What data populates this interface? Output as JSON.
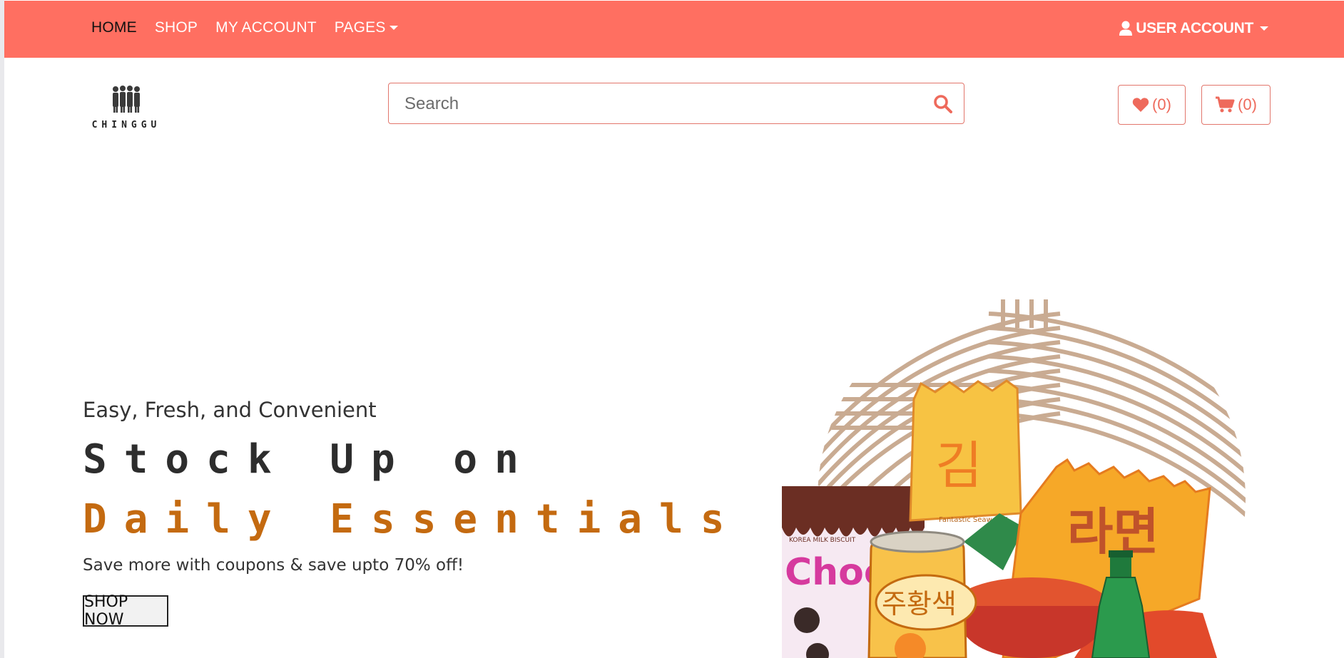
{
  "nav": {
    "items": [
      {
        "label": "HOME",
        "active": true
      },
      {
        "label": "SHOP",
        "active": false
      },
      {
        "label": "MY ACCOUNT",
        "active": false
      },
      {
        "label": "PAGES",
        "active": false,
        "dropdown": true
      }
    ],
    "account_label": "USER ACCOUNT"
  },
  "brand": {
    "logo_text": "CHINGGU"
  },
  "search": {
    "placeholder": "Search"
  },
  "wishlist": {
    "count_label": "(0)"
  },
  "cart": {
    "count_label": "(0)"
  },
  "hero": {
    "subtitle": "Easy, Fresh, and Convenient",
    "line1": "Stock Up on",
    "line2": "Daily Essentials",
    "description": "Save more with coupons & save upto 70% off!",
    "cta": "SHOP NOW"
  },
  "illustration": {
    "snack_labels": [
      "김",
      "라면",
      "주황색",
      "Choc",
      "KOREA MILK BISCUIT",
      "Fantastic Seaweed!"
    ]
  },
  "colors": {
    "topbar": "#ff6f61",
    "accent": "#ee6a5c",
    "hero_highlight": "#c46a10",
    "pattern": "#c9ab92"
  },
  "icons": [
    "user-icon",
    "caret-down-icon",
    "search-icon",
    "heart-icon",
    "cart-icon"
  ]
}
